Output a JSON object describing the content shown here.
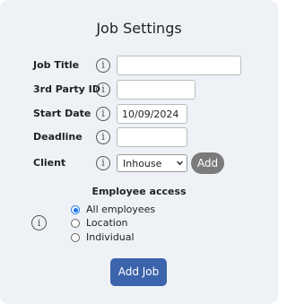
{
  "title": "Job Settings",
  "fields": {
    "job_title": {
      "label": "Job Title",
      "value": ""
    },
    "third_party_id": {
      "label": "3rd Party ID",
      "value": ""
    },
    "start_date": {
      "label": "Start Date",
      "value": "10/09/2024"
    },
    "deadline": {
      "label": "Deadline",
      "value": ""
    },
    "client": {
      "label": "Client",
      "selected": "Inhouse",
      "add_label": "Add"
    }
  },
  "info_glyph": "i",
  "employee_access": {
    "heading": "Employee access",
    "options": [
      {
        "label": "All employees",
        "checked": true
      },
      {
        "label": "Location",
        "checked": false
      },
      {
        "label": "Individual",
        "checked": false
      }
    ]
  },
  "submit_label": "Add Job",
  "colors": {
    "panel_bg": "#eef2f6",
    "primary_button": "#3c64ad",
    "secondary_button": "#7b7b7b",
    "radio_accent": "#1a73e8"
  },
  "icons": {
    "info": "info-circle-icon",
    "dropdown": "chevron-down-icon"
  }
}
